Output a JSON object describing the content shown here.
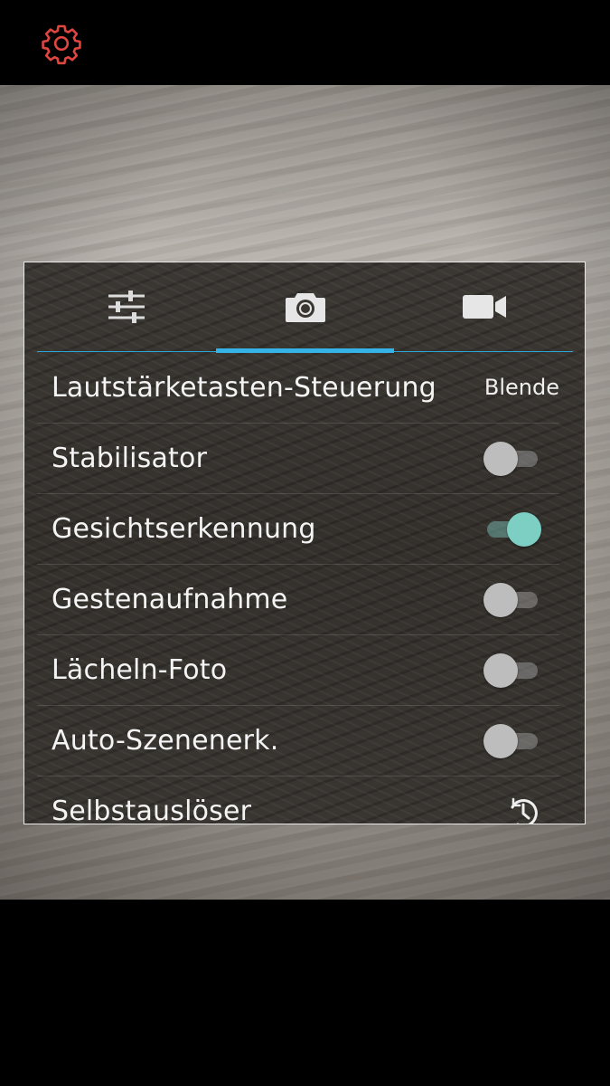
{
  "top_bar": {
    "settings_icon": "gear-icon",
    "settings_icon_color": "#e0463f"
  },
  "panel": {
    "tabs": [
      {
        "icon": "sliders-icon",
        "selected": false
      },
      {
        "icon": "camera-icon",
        "selected": true
      },
      {
        "icon": "video-camera-icon",
        "selected": false
      }
    ],
    "accent_color": "#36b3e6",
    "rows": [
      {
        "label": "Lautstärketasten-Steuerung",
        "value": "Blende"
      },
      {
        "label": "Stabilisator",
        "toggle": false
      },
      {
        "label": "Gesichtserkennung",
        "toggle": true
      },
      {
        "label": "Gestenaufnahme",
        "toggle": false
      },
      {
        "label": "Lächeln-Foto",
        "toggle": false
      },
      {
        "label": "Auto-Szenenerk.",
        "toggle": false
      },
      {
        "label": "Selbstauslöser",
        "icon": "timer-icon"
      }
    ]
  }
}
